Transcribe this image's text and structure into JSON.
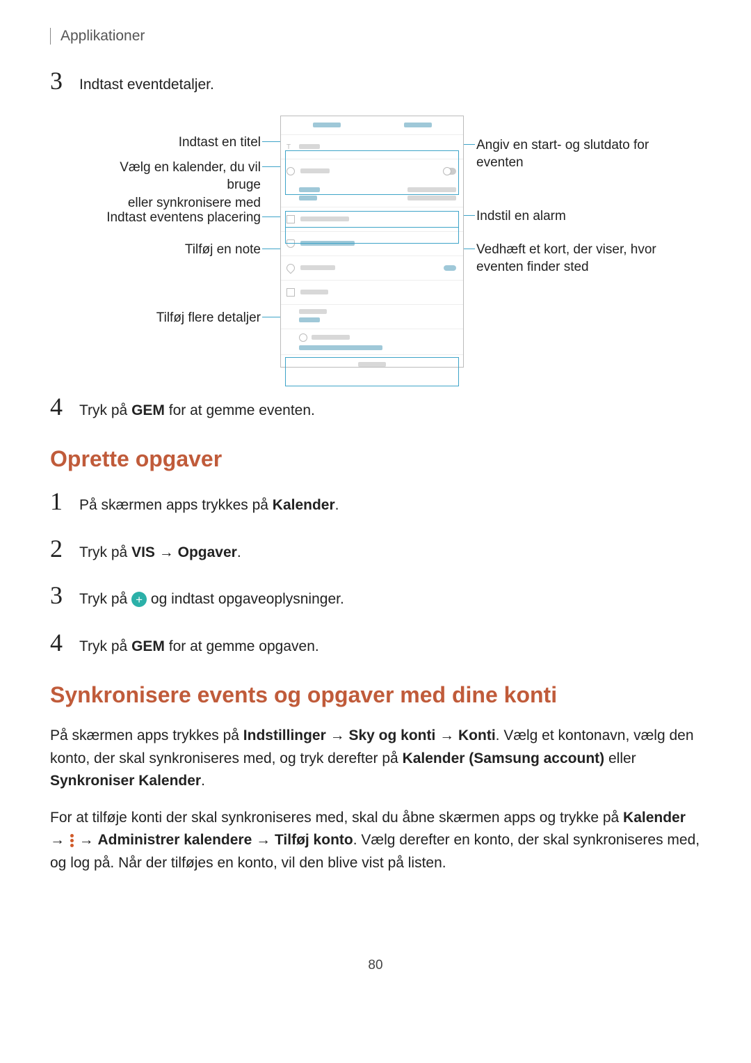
{
  "header": {
    "breadcrumb": "Applikationer"
  },
  "section1": {
    "step3": {
      "num": "3",
      "text": "Indtast eventdetaljer."
    }
  },
  "diagram": {
    "labels_left": {
      "title": "Indtast en titel",
      "calendar_l1": "Vælg en kalender, du vil bruge",
      "calendar_l2": "eller synkronisere med",
      "location": "Indtast eventens placering",
      "note": "Tilføj en note",
      "more": "Tilføj flere detaljer"
    },
    "labels_right": {
      "dates_l1": "Angiv en start- og slutdato for",
      "dates_l2": "eventen",
      "alarm": "Indstil en alarm",
      "map_l1": "Vedhæft et kort, der viser, hvor",
      "map_l2": "eventen finder sted"
    }
  },
  "section1b": {
    "step4_num": "4",
    "step4_pre": "Tryk på ",
    "step4_bold": "GEM",
    "step4_post": " for at gemme eventen."
  },
  "section2": {
    "heading": "Oprette opgaver",
    "step1_num": "1",
    "step1_pre": "På skærmen apps trykkes på ",
    "step1_bold": "Kalender",
    "step1_post": ".",
    "step2_num": "2",
    "step2_pre": "Tryk på ",
    "step2_b1": "VIS",
    "step2_arrow": " → ",
    "step2_b2": "Opgaver",
    "step2_post": ".",
    "step3_num": "3",
    "step3_pre": "Tryk på ",
    "step3_post": " og indtast opgaveoplysninger.",
    "step4_num": "4",
    "step4_pre": "Tryk på ",
    "step4_bold": "GEM",
    "step4_post": " for at gemme opgaven."
  },
  "section3": {
    "heading": "Synkronisere events og opgaver med dine konti",
    "p1_a": "På skærmen apps trykkes på ",
    "p1_b1": "Indstillinger",
    "p1_arr": " → ",
    "p1_b2": "Sky og konti",
    "p1_b3": "Konti",
    "p1_c": ". Vælg et kontonavn, vælg den konto, der skal synkroniseres med, og tryk derefter på ",
    "p1_b4": "Kalender (Samsung account)",
    "p1_d": " eller ",
    "p1_b5": "Synkroniser Kalender",
    "p1_e": ".",
    "p2_a": "For at tilføje konti der skal synkroniseres med, skal du åbne skærmen apps og trykke på ",
    "p2_b1": "Kalender",
    "p2_arr1": " → ",
    "p2_arr2": " → ",
    "p2_b2": "Administrer kalendere",
    "p2_b3": "Tilføj konto",
    "p2_c": ". Vælg derefter en konto, der skal synkroniseres med, og log på. Når der tilføjes en konto, vil den blive vist på listen."
  },
  "page_number": "80"
}
